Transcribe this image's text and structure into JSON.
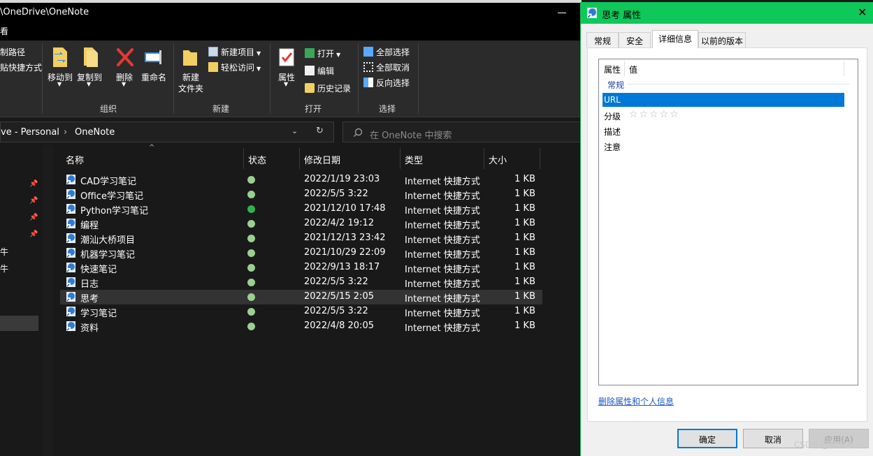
{
  "explorer": {
    "title_path": "\\OneDrive\\OneNote",
    "menu_fragment": "看",
    "ribbon": {
      "partial_items": [
        "制路径",
        "贴快捷方式"
      ],
      "organize": {
        "move_to": "移动到",
        "copy_to": "复制到",
        "delete": "删除",
        "rename": "重命名",
        "label": "组织"
      },
      "new": {
        "new_folder_line1": "新建",
        "new_folder_line2": "文件夹",
        "new_item": "新建项目",
        "easy_access": "轻松访问",
        "label": "新建"
      },
      "open": {
        "properties": "属性",
        "open": "打开",
        "edit": "编辑",
        "history": "历史记录",
        "label": "打开"
      },
      "select": {
        "select_all": "全部选择",
        "select_none": "全部取消",
        "invert": "反向选择",
        "label": "选择"
      }
    },
    "address": {
      "crumb1": "ve - Personal",
      "crumb2": "OneNote",
      "search_placeholder": "在 OneNote 中搜索"
    },
    "nav_fragments": [
      "牛",
      "牛"
    ],
    "columns": {
      "name": "名称",
      "status": "状态",
      "modified": "修改日期",
      "type": "类型",
      "size": "大小"
    },
    "files": [
      {
        "name": "CAD学习笔记",
        "date": "2022/1/19 23:03",
        "type": "Internet 快捷方式",
        "size": "1 KB"
      },
      {
        "name": "Office学习笔记",
        "date": "2022/5/5 3:22",
        "type": "Internet 快捷方式",
        "size": "1 KB"
      },
      {
        "name": "Python学习笔记",
        "date": "2021/12/10 17:48",
        "type": "Internet 快捷方式",
        "size": "1 KB"
      },
      {
        "name": "编程",
        "date": "2022/4/2 19:12",
        "type": "Internet 快捷方式",
        "size": "1 KB"
      },
      {
        "name": "潮汕大桥项目",
        "date": "2021/12/13 23:42",
        "type": "Internet 快捷方式",
        "size": "1 KB"
      },
      {
        "name": "机器学习笔记",
        "date": "2021/10/29 22:09",
        "type": "Internet 快捷方式",
        "size": "1 KB"
      },
      {
        "name": "快速笔记",
        "date": "2022/9/13 18:17",
        "type": "Internet 快捷方式",
        "size": "1 KB"
      },
      {
        "name": "日志",
        "date": "2022/5/5 3:22",
        "type": "Internet 快捷方式",
        "size": "1 KB"
      },
      {
        "name": "思考",
        "date": "2022/5/15 2:05",
        "type": "Internet 快捷方式",
        "size": "1 KB"
      },
      {
        "name": "学习笔记",
        "date": "2022/5/5 3:22",
        "type": "Internet 快捷方式",
        "size": "1 KB"
      },
      {
        "name": "资料",
        "date": "2022/4/8 20:05",
        "type": "Internet 快捷方式",
        "size": "1 KB"
      }
    ]
  },
  "dialog": {
    "title": "思考 属性",
    "tabs": [
      "常规",
      "安全",
      "详细信息",
      "以前的版本"
    ],
    "list_headers": {
      "property": "属性",
      "value": "值"
    },
    "group": "常规",
    "props": [
      "URL",
      "分级",
      "描述",
      "注意"
    ],
    "rating_stars": "☆☆☆☆☆",
    "remove_link": "删除属性和个人信息",
    "buttons": {
      "ok": "确定",
      "cancel": "取消",
      "apply": "应用(A)"
    }
  },
  "watermark": "CSDN @撑伞客",
  "colors": {
    "accent_green": "#0ec85a",
    "selection_blue": "#0078d7",
    "sync_green": "#2fb34a"
  }
}
